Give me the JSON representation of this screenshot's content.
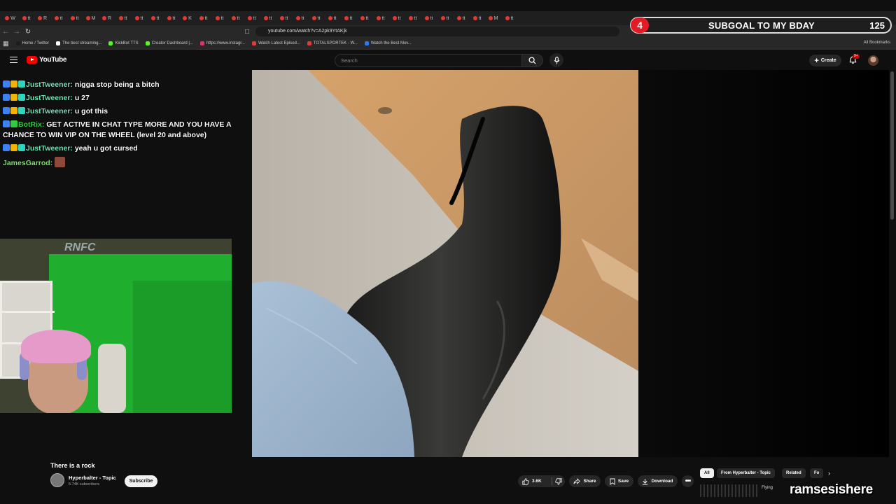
{
  "browser": {
    "url": "youtube.com/watch?v=A2pk9YtAKjk",
    "tabs": [
      "W",
      "tt",
      "R",
      "tt",
      "tt",
      "M",
      "R",
      "tt",
      "tt",
      "tt",
      "tt",
      "K",
      "tt",
      "tt",
      "tt",
      "tt",
      "tt",
      "tt",
      "tt",
      "tt",
      "tt",
      "tt",
      "tt",
      "tt",
      "tt",
      "tt",
      "tt",
      "tt",
      "tt",
      "tt",
      "M",
      "tt"
    ],
    "bookmarks": [
      {
        "label": "Home / Twitter",
        "color": "#1d1d1d"
      },
      {
        "label": "The best streaming...",
        "color": "#ffffff"
      },
      {
        "label": "KickBot TTS",
        "color": "#53fc18"
      },
      {
        "label": "Creator Dashboard |...",
        "color": "#53fc18"
      },
      {
        "label": "https://www.instagr...",
        "color": "#e1306c"
      },
      {
        "label": "Watch Latest Episod...",
        "color": "#e53935"
      },
      {
        "label": "TOTALSPORTEK - W...",
        "color": "#e53935"
      },
      {
        "label": "Watch the Best Mov...",
        "color": "#2979ff"
      }
    ],
    "all_bookmarks": "All Bookmarks"
  },
  "subgoal": {
    "count": "4",
    "title": "SUBGOAL TO MY BDAY",
    "target": "125"
  },
  "header": {
    "logo_text": "YouTube",
    "search_placeholder": "Search",
    "create_label": "Create",
    "notifications_badge": "9+"
  },
  "chat": [
    {
      "user": "JustTweener",
      "message": "nigga stop being a bitch",
      "style": "normal"
    },
    {
      "user": "JustTweener",
      "message": "u 27",
      "style": "normal"
    },
    {
      "user": "JustTweener",
      "message": "u got this",
      "style": "normal"
    },
    {
      "user": "BotRix",
      "message": "GET ACTIVE IN CHAT TYPE MORE AND YOU HAVE A CHANCE TO WIN VIP ON THE WHEEL (level 20 and above)",
      "style": "bot"
    },
    {
      "user": "JustTweener",
      "message": "yeah u got cursed",
      "style": "normal"
    },
    {
      "user": "JamesGarrod",
      "message": "",
      "style": "james"
    }
  ],
  "webcam": {
    "banner_text": "RNFC"
  },
  "video": {
    "title": "There is a rock",
    "channel": "Hyperbalter - Topic",
    "subscribers": "5.74K subscribers",
    "subscribe_label": "Subscribe",
    "likes": "3.6K",
    "share_label": "Share",
    "save_label": "Save",
    "download_label": "Download"
  },
  "chips": {
    "all": "All",
    "from": "From Hyperbalter - Topic",
    "related": "Related",
    "more": "Fo"
  },
  "overlay": {
    "streamer": "ramsesishere",
    "mini_label": "Flying"
  }
}
